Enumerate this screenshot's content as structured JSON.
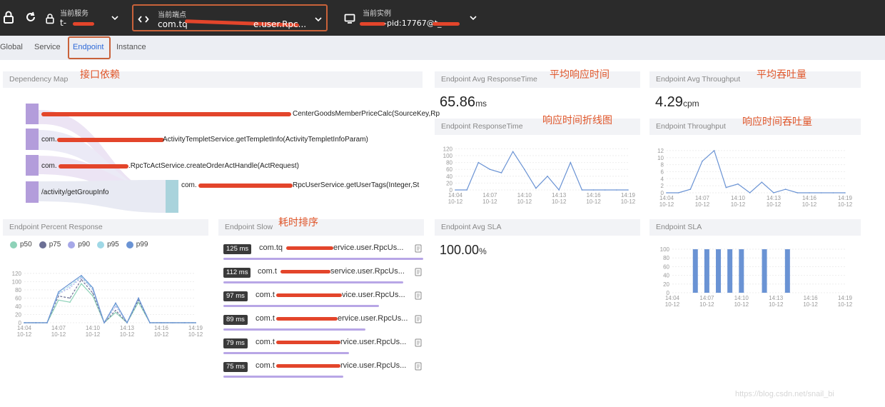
{
  "topbar": {
    "service": {
      "caption": "当前服务",
      "value": "t-"
    },
    "endpoint": {
      "caption": "当前端点",
      "value": "com.tq",
      "value_end": "e.user.Rpc..."
    },
    "instance": {
      "caption": "当前实例",
      "value": "-pid:17767@t_"
    }
  },
  "tabs": [
    "Global",
    "Service",
    "Endpoint",
    "Instance"
  ],
  "panels": {
    "dependency_map": {
      "title": "Dependency Map",
      "annotation": "接口依赖",
      "nodes": [
        "CenterGoodsMemberPriceCalc(SourceKey,Rp",
        "com.",
        "ActivityTempletService.getTempletInfo(ActivityTempletInfoParam)",
        "com.",
        ".RpcTcActService.createOrderActHandle(ActRequest)",
        "/activity/getGroupInfo"
      ],
      "target_prefix": "com.",
      "target": "RpcUserService.getUserTags(Integer,St"
    },
    "avg_response": {
      "title": "Endpoint Avg ResponseTime",
      "annotation": "平均响应时间",
      "value": "65.86",
      "unit": "ms"
    },
    "avg_throughput": {
      "title": "Endpoint Avg Throughput",
      "annotation": "平均吞吐量",
      "value": "4.29",
      "unit": "cpm"
    },
    "response_time": {
      "title": "Endpoint ResponseTime",
      "annotation": "响应时间折线图"
    },
    "throughput": {
      "title": "Endpoint Throughput",
      "annotation": "响应时间吞吐量"
    },
    "percent_response": {
      "title": "Endpoint Percent Response",
      "legend": [
        "p50",
        "p75",
        "p90",
        "p95",
        "p99"
      ]
    },
    "slow": {
      "title": "Endpoint Slow",
      "annotation": "耗时排序",
      "rows": [
        {
          "ms": "125 ms",
          "name_start": "com.tq",
          "name_end": "ervice.user.RpcUs...",
          "fraction": 1.0
        },
        {
          "ms": "112 ms",
          "name_start": "com.t",
          "name_end": "service.user.RpcUs...",
          "fraction": 0.9
        },
        {
          "ms": "97 ms",
          "name_start": "com.t",
          "name_end": "vice.user.RpcUs...",
          "fraction": 0.78
        },
        {
          "ms": "89 ms",
          "name_start": "com.t",
          "name_end": "ervice.user.RpcUs...",
          "fraction": 0.71
        },
        {
          "ms": "79 ms",
          "name_start": "com.t",
          "name_end": "rvice.user.RpcUs...",
          "fraction": 0.63
        },
        {
          "ms": "75 ms",
          "name_start": "com.t",
          "name_end": "rvice.user.RpcUs...",
          "fraction": 0.6
        }
      ]
    },
    "avg_sla": {
      "title": "Endpoint Avg SLA",
      "value": "100.00",
      "unit": "%"
    },
    "sla": {
      "title": "Endpoint SLA"
    }
  },
  "colors": {
    "accent": "#2f6ad8",
    "line": "#6a93d4",
    "annotation": "#e0562a",
    "redaction": "#e3452b"
  },
  "chart_data": [
    {
      "type": "line",
      "title": "Endpoint ResponseTime",
      "x": [
        "14:04\n10-12",
        "14:05\n10-12",
        "14:06\n10-12",
        "14:07\n10-12",
        "14:08\n10-12",
        "14:09\n10-12",
        "14:10\n10-12",
        "14:11\n10-12",
        "14:12\n10-12",
        "14:13\n10-12",
        "14:14\n10-12",
        "14:15\n10-12",
        "14:16\n10-12",
        "14:17\n10-12",
        "14:18\n10-12",
        "14:19\n10-12"
      ],
      "values": [
        0,
        0,
        80,
        60,
        50,
        112,
        60,
        5,
        40,
        0,
        80,
        0,
        0,
        0,
        0,
        0
      ],
      "yticks": [
        0,
        20,
        40,
        60,
        80,
        100,
        120
      ],
      "ylim": [
        0,
        125
      ],
      "xticks": [
        "14:04",
        "14:07",
        "14:10",
        "14:13",
        "14:16",
        "14:19"
      ],
      "xtick_sub": "10-12"
    },
    {
      "type": "line",
      "title": "Endpoint Throughput",
      "values": [
        0,
        0,
        1,
        9,
        12,
        1.5,
        2.5,
        0,
        3,
        0,
        1,
        0,
        0,
        0,
        0,
        0
      ],
      "yticks": [
        0,
        2,
        4,
        6,
        8,
        10,
        12
      ],
      "ylim": [
        0,
        13
      ],
      "xticks": [
        "14:04",
        "14:07",
        "14:10",
        "14:13",
        "14:16",
        "14:19"
      ],
      "xtick_sub": "10-12"
    },
    {
      "type": "line",
      "title": "Endpoint Percent Response",
      "series": [
        {
          "name": "p50",
          "values": [
            0,
            0,
            0,
            55,
            50,
            95,
            65,
            0,
            25,
            0,
            50,
            0,
            0,
            0,
            0,
            0
          ]
        },
        {
          "name": "p75",
          "values": [
            0,
            0,
            0,
            65,
            60,
            105,
            72,
            0,
            30,
            0,
            55,
            0,
            0,
            0,
            0,
            0
          ]
        },
        {
          "name": "p90",
          "values": [
            0,
            0,
            0,
            70,
            85,
            110,
            80,
            0,
            40,
            0,
            60,
            0,
            0,
            0,
            0,
            0
          ]
        },
        {
          "name": "p95",
          "values": [
            0,
            0,
            0,
            72,
            90,
            112,
            82,
            0,
            45,
            0,
            60,
            0,
            0,
            0,
            0,
            0
          ]
        },
        {
          "name": "p99",
          "values": [
            0,
            0,
            0,
            75,
            95,
            115,
            85,
            0,
            48,
            0,
            60,
            0,
            0,
            0,
            0,
            0
          ]
        }
      ],
      "yticks": [
        0,
        20,
        40,
        60,
        80,
        100,
        120
      ],
      "ylim": [
        0,
        125
      ],
      "xticks": [
        "14:04",
        "14:07",
        "14:10",
        "14:13",
        "14:16",
        "14:19"
      ],
      "xtick_sub": "10-12"
    },
    {
      "type": "bar",
      "title": "Endpoint SLA",
      "values": [
        0,
        0,
        100,
        100,
        100,
        100,
        100,
        0,
        100,
        0,
        100,
        0,
        0,
        0,
        0,
        0
      ],
      "yticks": [
        0,
        20,
        40,
        60,
        80,
        100
      ],
      "ylim": [
        0,
        105
      ],
      "xticks": [
        "14:04",
        "14:07",
        "14:10",
        "14:13",
        "14:16",
        "14:19"
      ],
      "xtick_sub": "10-12"
    }
  ]
}
